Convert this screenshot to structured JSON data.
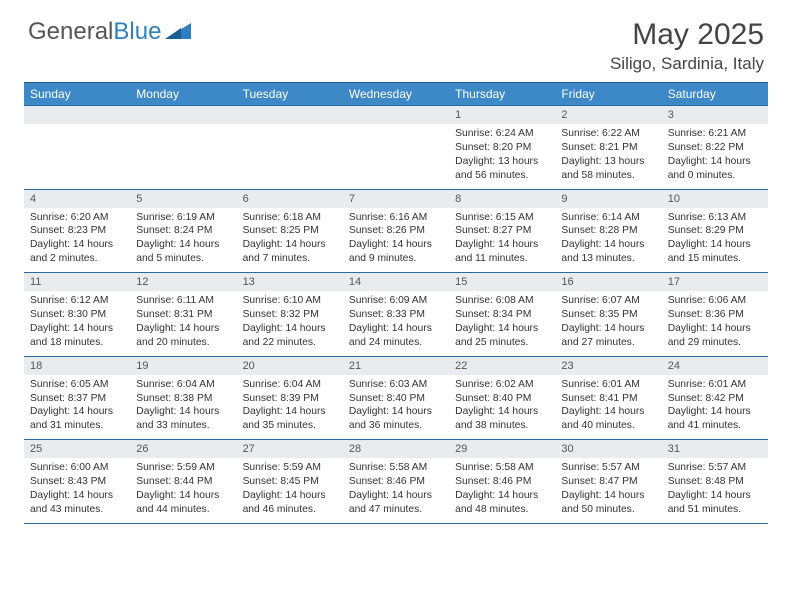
{
  "logo": {
    "text1": "General",
    "text2": "Blue"
  },
  "title": "May 2025",
  "location": "Siligo, Sardinia, Italy",
  "dow": [
    "Sunday",
    "Monday",
    "Tuesday",
    "Wednesday",
    "Thursday",
    "Friday",
    "Saturday"
  ],
  "weeks": [
    [
      {
        "n": "",
        "sr": "",
        "ss": "",
        "dl": ""
      },
      {
        "n": "",
        "sr": "",
        "ss": "",
        "dl": ""
      },
      {
        "n": "",
        "sr": "",
        "ss": "",
        "dl": ""
      },
      {
        "n": "",
        "sr": "",
        "ss": "",
        "dl": ""
      },
      {
        "n": "1",
        "sr": "Sunrise: 6:24 AM",
        "ss": "Sunset: 8:20 PM",
        "dl": "Daylight: 13 hours and 56 minutes."
      },
      {
        "n": "2",
        "sr": "Sunrise: 6:22 AM",
        "ss": "Sunset: 8:21 PM",
        "dl": "Daylight: 13 hours and 58 minutes."
      },
      {
        "n": "3",
        "sr": "Sunrise: 6:21 AM",
        "ss": "Sunset: 8:22 PM",
        "dl": "Daylight: 14 hours and 0 minutes."
      }
    ],
    [
      {
        "n": "4",
        "sr": "Sunrise: 6:20 AM",
        "ss": "Sunset: 8:23 PM",
        "dl": "Daylight: 14 hours and 2 minutes."
      },
      {
        "n": "5",
        "sr": "Sunrise: 6:19 AM",
        "ss": "Sunset: 8:24 PM",
        "dl": "Daylight: 14 hours and 5 minutes."
      },
      {
        "n": "6",
        "sr": "Sunrise: 6:18 AM",
        "ss": "Sunset: 8:25 PM",
        "dl": "Daylight: 14 hours and 7 minutes."
      },
      {
        "n": "7",
        "sr": "Sunrise: 6:16 AM",
        "ss": "Sunset: 8:26 PM",
        "dl": "Daylight: 14 hours and 9 minutes."
      },
      {
        "n": "8",
        "sr": "Sunrise: 6:15 AM",
        "ss": "Sunset: 8:27 PM",
        "dl": "Daylight: 14 hours and 11 minutes."
      },
      {
        "n": "9",
        "sr": "Sunrise: 6:14 AM",
        "ss": "Sunset: 8:28 PM",
        "dl": "Daylight: 14 hours and 13 minutes."
      },
      {
        "n": "10",
        "sr": "Sunrise: 6:13 AM",
        "ss": "Sunset: 8:29 PM",
        "dl": "Daylight: 14 hours and 15 minutes."
      }
    ],
    [
      {
        "n": "11",
        "sr": "Sunrise: 6:12 AM",
        "ss": "Sunset: 8:30 PM",
        "dl": "Daylight: 14 hours and 18 minutes."
      },
      {
        "n": "12",
        "sr": "Sunrise: 6:11 AM",
        "ss": "Sunset: 8:31 PM",
        "dl": "Daylight: 14 hours and 20 minutes."
      },
      {
        "n": "13",
        "sr": "Sunrise: 6:10 AM",
        "ss": "Sunset: 8:32 PM",
        "dl": "Daylight: 14 hours and 22 minutes."
      },
      {
        "n": "14",
        "sr": "Sunrise: 6:09 AM",
        "ss": "Sunset: 8:33 PM",
        "dl": "Daylight: 14 hours and 24 minutes."
      },
      {
        "n": "15",
        "sr": "Sunrise: 6:08 AM",
        "ss": "Sunset: 8:34 PM",
        "dl": "Daylight: 14 hours and 25 minutes."
      },
      {
        "n": "16",
        "sr": "Sunrise: 6:07 AM",
        "ss": "Sunset: 8:35 PM",
        "dl": "Daylight: 14 hours and 27 minutes."
      },
      {
        "n": "17",
        "sr": "Sunrise: 6:06 AM",
        "ss": "Sunset: 8:36 PM",
        "dl": "Daylight: 14 hours and 29 minutes."
      }
    ],
    [
      {
        "n": "18",
        "sr": "Sunrise: 6:05 AM",
        "ss": "Sunset: 8:37 PM",
        "dl": "Daylight: 14 hours and 31 minutes."
      },
      {
        "n": "19",
        "sr": "Sunrise: 6:04 AM",
        "ss": "Sunset: 8:38 PM",
        "dl": "Daylight: 14 hours and 33 minutes."
      },
      {
        "n": "20",
        "sr": "Sunrise: 6:04 AM",
        "ss": "Sunset: 8:39 PM",
        "dl": "Daylight: 14 hours and 35 minutes."
      },
      {
        "n": "21",
        "sr": "Sunrise: 6:03 AM",
        "ss": "Sunset: 8:40 PM",
        "dl": "Daylight: 14 hours and 36 minutes."
      },
      {
        "n": "22",
        "sr": "Sunrise: 6:02 AM",
        "ss": "Sunset: 8:40 PM",
        "dl": "Daylight: 14 hours and 38 minutes."
      },
      {
        "n": "23",
        "sr": "Sunrise: 6:01 AM",
        "ss": "Sunset: 8:41 PM",
        "dl": "Daylight: 14 hours and 40 minutes."
      },
      {
        "n": "24",
        "sr": "Sunrise: 6:01 AM",
        "ss": "Sunset: 8:42 PM",
        "dl": "Daylight: 14 hours and 41 minutes."
      }
    ],
    [
      {
        "n": "25",
        "sr": "Sunrise: 6:00 AM",
        "ss": "Sunset: 8:43 PM",
        "dl": "Daylight: 14 hours and 43 minutes."
      },
      {
        "n": "26",
        "sr": "Sunrise: 5:59 AM",
        "ss": "Sunset: 8:44 PM",
        "dl": "Daylight: 14 hours and 44 minutes."
      },
      {
        "n": "27",
        "sr": "Sunrise: 5:59 AM",
        "ss": "Sunset: 8:45 PM",
        "dl": "Daylight: 14 hours and 46 minutes."
      },
      {
        "n": "28",
        "sr": "Sunrise: 5:58 AM",
        "ss": "Sunset: 8:46 PM",
        "dl": "Daylight: 14 hours and 47 minutes."
      },
      {
        "n": "29",
        "sr": "Sunrise: 5:58 AM",
        "ss": "Sunset: 8:46 PM",
        "dl": "Daylight: 14 hours and 48 minutes."
      },
      {
        "n": "30",
        "sr": "Sunrise: 5:57 AM",
        "ss": "Sunset: 8:47 PM",
        "dl": "Daylight: 14 hours and 50 minutes."
      },
      {
        "n": "31",
        "sr": "Sunrise: 5:57 AM",
        "ss": "Sunset: 8:48 PM",
        "dl": "Daylight: 14 hours and 51 minutes."
      }
    ]
  ]
}
